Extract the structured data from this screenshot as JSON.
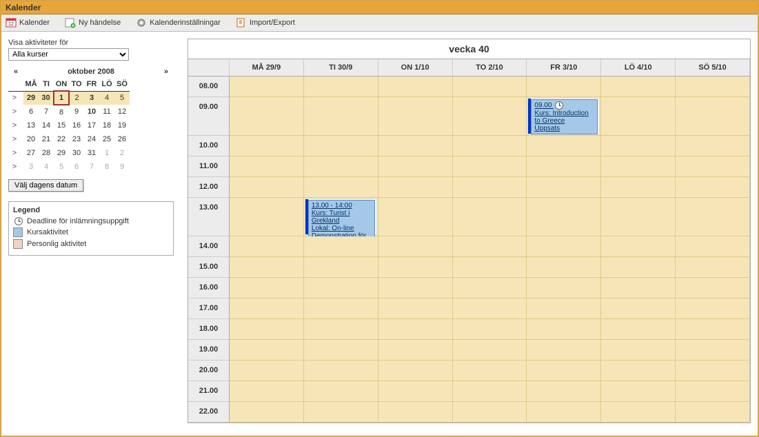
{
  "app_title": "Kalender",
  "toolbar": {
    "calendar": "Kalender",
    "new_event": "Ny händelse",
    "settings": "Kalenderinställningar",
    "import_export": "Import/Export"
  },
  "sidebar": {
    "filter_label": "Visa aktiviteter för",
    "course_selected": "Alla kurser",
    "today_button": "Välj dagens datum"
  },
  "mini_calendar": {
    "prev": "«",
    "next": "»",
    "title": "oktober 2008",
    "day_headers": [
      "MÅ",
      "TI",
      "ON",
      "TO",
      "FR",
      "LÖ",
      "SÖ"
    ],
    "weeks": [
      {
        "wk": ">",
        "days": [
          {
            "d": "29",
            "bold": true
          },
          {
            "d": "30",
            "bold": true
          },
          {
            "d": "1",
            "today": true
          },
          {
            "d": "2"
          },
          {
            "d": "3",
            "bold": true
          },
          {
            "d": "4"
          },
          {
            "d": "5"
          }
        ],
        "current": true
      },
      {
        "wk": ">",
        "days": [
          {
            "d": "6"
          },
          {
            "d": "7"
          },
          {
            "d": "8"
          },
          {
            "d": "9"
          },
          {
            "d": "10",
            "bold": true
          },
          {
            "d": "11"
          },
          {
            "d": "12"
          }
        ]
      },
      {
        "wk": ">",
        "days": [
          {
            "d": "13"
          },
          {
            "d": "14"
          },
          {
            "d": "15"
          },
          {
            "d": "16"
          },
          {
            "d": "17"
          },
          {
            "d": "18"
          },
          {
            "d": "19"
          }
        ]
      },
      {
        "wk": ">",
        "days": [
          {
            "d": "20"
          },
          {
            "d": "21"
          },
          {
            "d": "22"
          },
          {
            "d": "23"
          },
          {
            "d": "24"
          },
          {
            "d": "25"
          },
          {
            "d": "26"
          }
        ]
      },
      {
        "wk": ">",
        "days": [
          {
            "d": "27"
          },
          {
            "d": "28"
          },
          {
            "d": "29"
          },
          {
            "d": "30"
          },
          {
            "d": "31"
          },
          {
            "d": "1",
            "other": true
          },
          {
            "d": "2",
            "other": true
          }
        ]
      },
      {
        "wk": ">",
        "days": [
          {
            "d": "3",
            "other": true
          },
          {
            "d": "4",
            "other": true
          },
          {
            "d": "5",
            "other": true
          },
          {
            "d": "6",
            "other": true
          },
          {
            "d": "7",
            "other": true
          },
          {
            "d": "8",
            "other": true
          },
          {
            "d": "9",
            "other": true
          }
        ]
      }
    ]
  },
  "legend": {
    "title": "Legend",
    "deadline": "Deadline för inlämningsuppgift",
    "course": "Kursaktivitet",
    "personal": "Personlig aktivitet"
  },
  "week_view": {
    "title": "vecka 40",
    "day_headers": [
      "MÅ 29/9",
      "TI 30/9",
      "ON 1/10",
      "TO 2/10",
      "FR 3/10",
      "LÖ 4/10",
      "SÖ 5/10"
    ],
    "hours": [
      "08.00",
      "09.00",
      "10.00",
      "11.00",
      "12.00",
      "13.00",
      "14.00",
      "15.00",
      "16.00",
      "17.00",
      "18.00",
      "19.00",
      "20.00",
      "21.00",
      "22.00"
    ],
    "tall_hours": [
      "09.00",
      "13.00"
    ],
    "events": [
      {
        "day": 4,
        "hour": "09.00",
        "time_label": "09.00",
        "line2": "Kurs: Introduction to Greece",
        "line3": "Uppsats",
        "has_clock": true
      },
      {
        "day": 1,
        "hour": "13.00",
        "time_label": "13.00 - 14:00",
        "line2": "Kurs: Turist i Grekland",
        "line3": "Lokal: On-line",
        "line4": "Demonstration för DI..."
      }
    ]
  }
}
